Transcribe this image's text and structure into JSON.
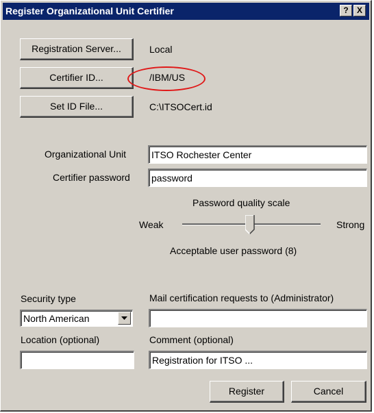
{
  "window": {
    "title": "Register Organizational Unit Certifier",
    "help_label": "?",
    "close_label": "X"
  },
  "registration_server": {
    "button": "Registration Server...",
    "value": "Local"
  },
  "certifier_id": {
    "button": "Certifier ID...",
    "value": "/IBM/US"
  },
  "id_file": {
    "button": "Set ID File...",
    "value": "C:\\ITSOCert.id"
  },
  "org_unit": {
    "label": "Organizational Unit",
    "value": "ITSO Rochester Center"
  },
  "password": {
    "label": "Certifier password",
    "value": "password"
  },
  "quality": {
    "title": "Password quality scale",
    "weak": "Weak",
    "strong": "Strong",
    "status": "Acceptable user password (8)",
    "level": 8
  },
  "security": {
    "label": "Security type",
    "selected": "North American"
  },
  "mail": {
    "label": "Mail certification requests to (Administrator)",
    "value": ""
  },
  "location": {
    "label": "Location (optional)",
    "value": ""
  },
  "comment": {
    "label": "Comment (optional)",
    "value": "Registration for ITSO ..."
  },
  "buttons": {
    "register": "Register",
    "cancel": "Cancel"
  },
  "colors": {
    "titlebar": "#0a246a",
    "face": "#d4d0c8",
    "highlight_oval": "#e01818"
  }
}
